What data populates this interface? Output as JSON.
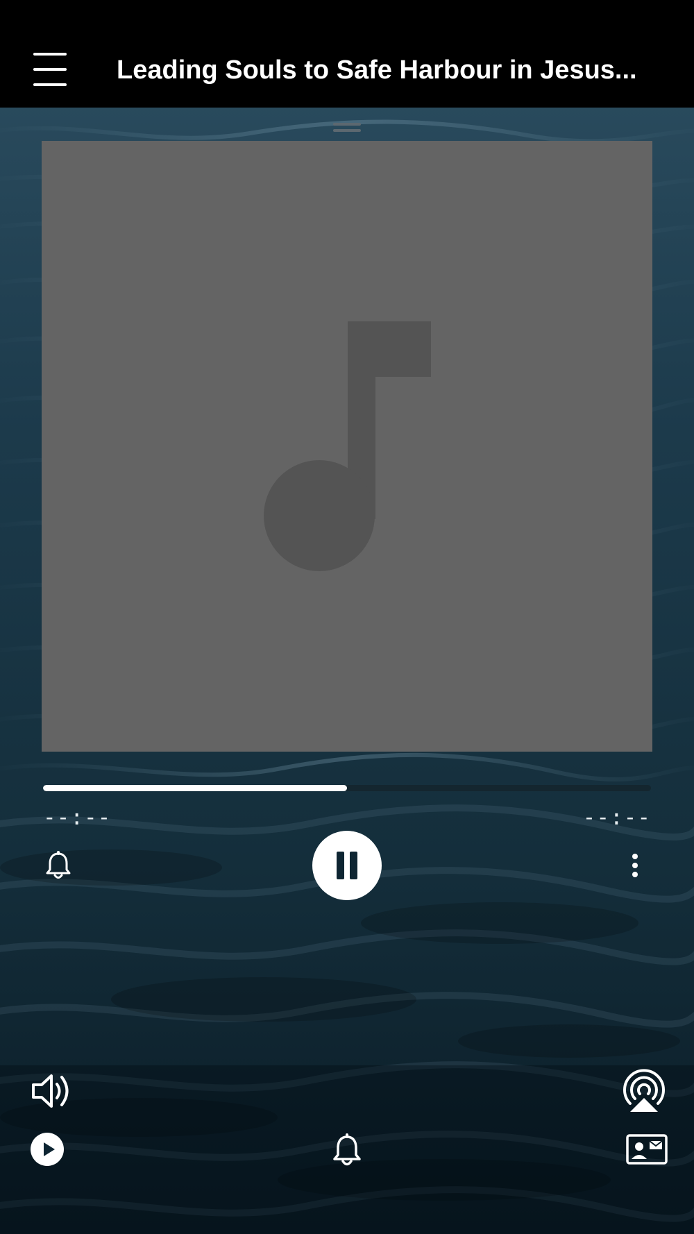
{
  "header": {
    "menu_icon": "hamburger-menu-icon",
    "title": "Leading Souls to Safe Harbour in Jesus..."
  },
  "artwork": {
    "placeholder_icon": "music-note-icon",
    "background_color": "#646464",
    "icon_color": "#545454"
  },
  "player": {
    "progress": 0.5,
    "elapsed_time": "--:--",
    "remaining_time": "--:--",
    "state": "playing"
  },
  "controls": {
    "left_icon": "bell-icon",
    "center_icon": "pause-icon",
    "right_icon": "more-vertical-icon"
  },
  "bottom_bar": {
    "volume_icon": "speaker-volume-icon",
    "airplay_icon": "airplay-icon",
    "play_icon": "play-circle-icon",
    "bell_icon": "bell-icon",
    "contact_icon": "contact-card-icon"
  },
  "colors": {
    "header_bg": "#000000",
    "ocean_bg": "#0e2532",
    "accent": "#ffffff"
  }
}
